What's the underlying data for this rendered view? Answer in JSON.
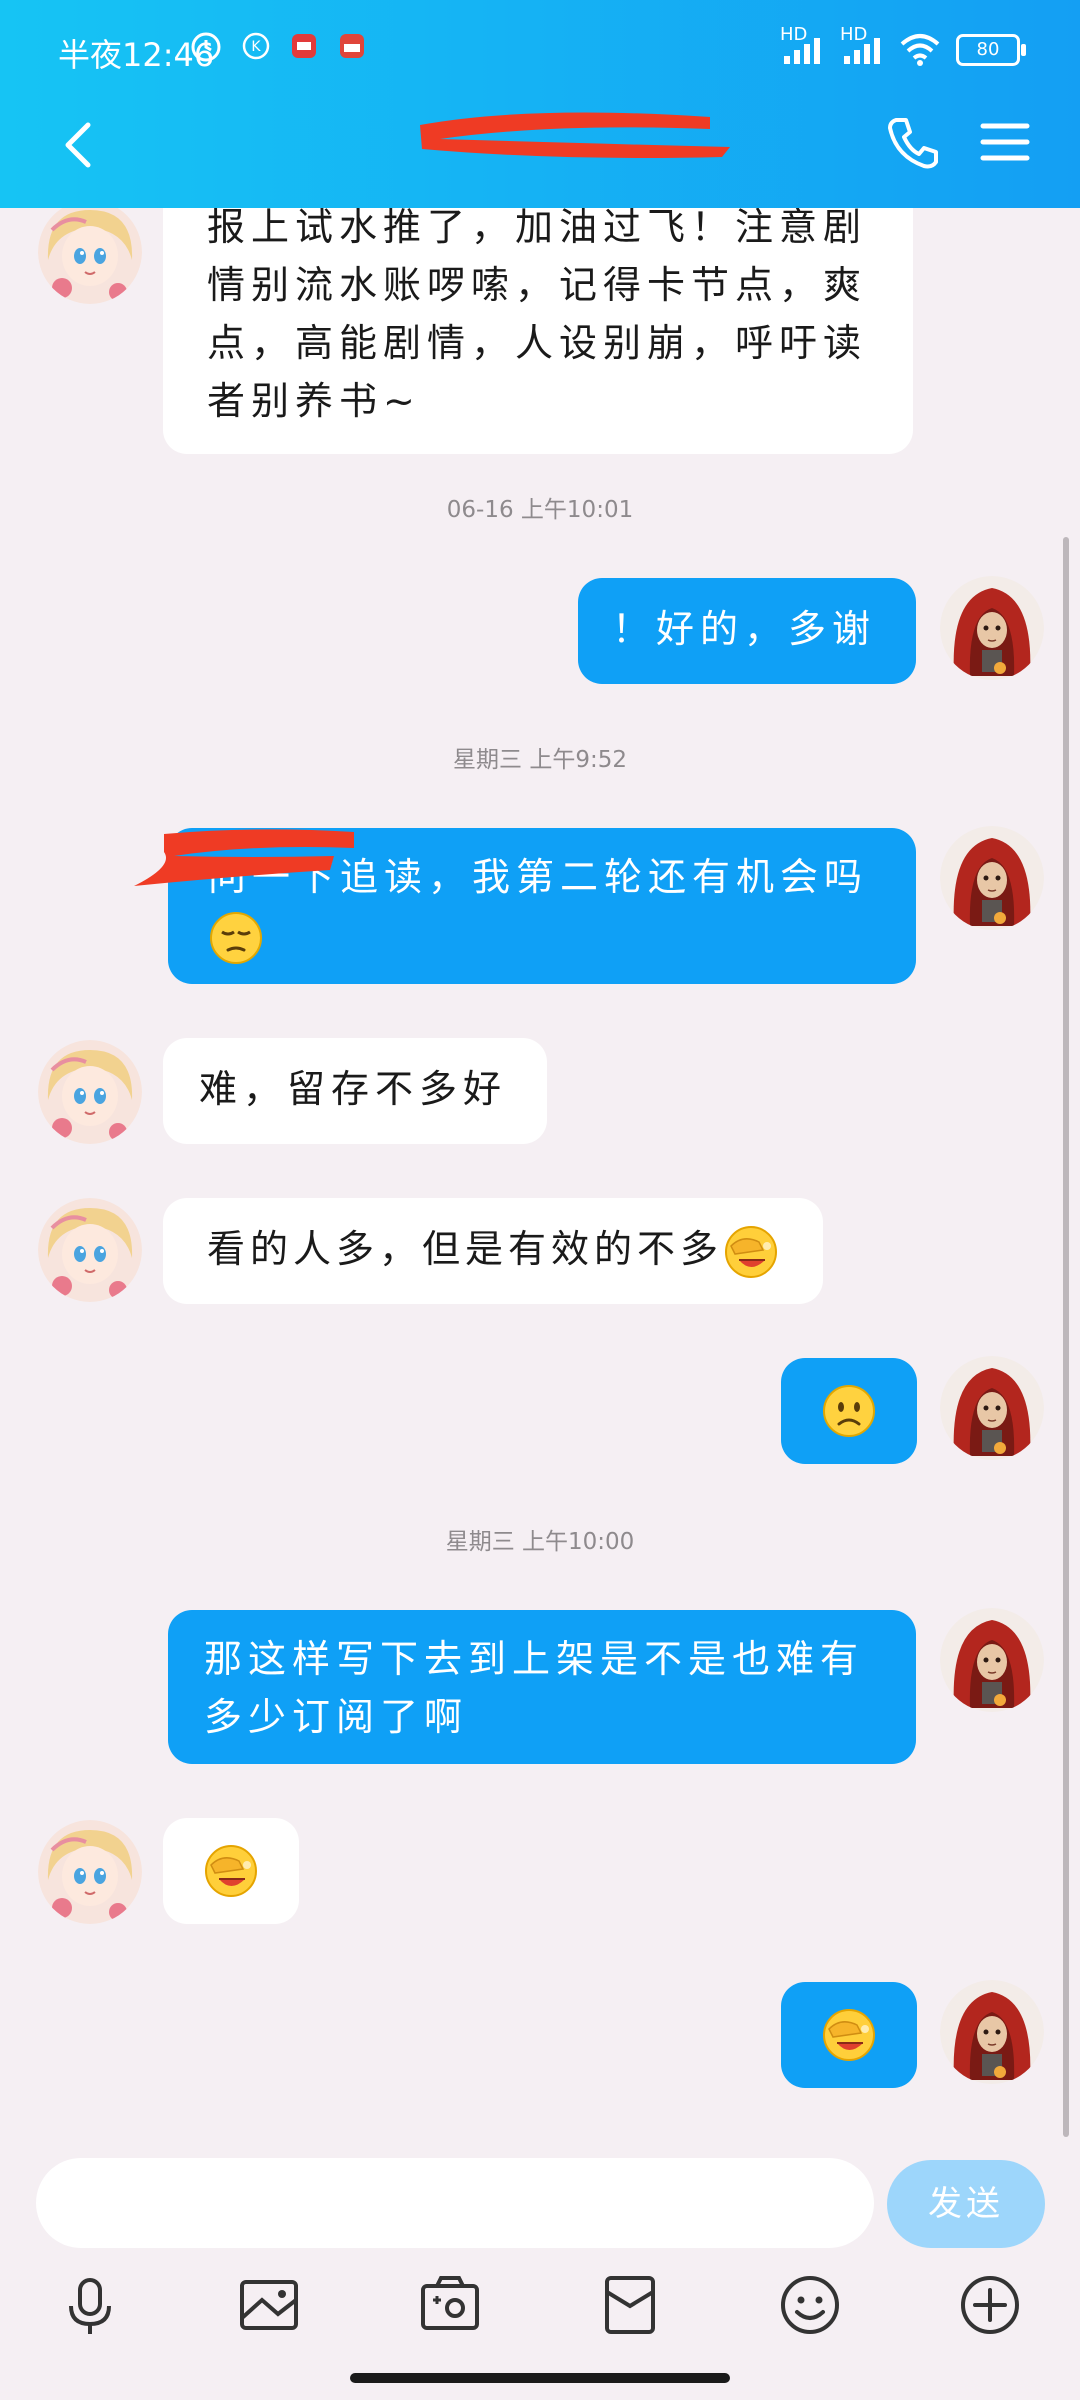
{
  "status_bar": {
    "time": "半夜12:46",
    "battery": "80",
    "signal1_label": "HD",
    "signal2_label": "HD"
  },
  "header": {
    "title": "",
    "back_icon": "chevron-left-icon",
    "call_icon": "phone-icon",
    "menu_icon": "menu-icon"
  },
  "messages": [
    {
      "side": "in",
      "text": "报上试水推了，加油过飞！注意剧情别流水账啰嗦，记得卡节点，爽点，高能剧情，人设别崩，呼吁读者别养书~"
    },
    {
      "timestamp": "06-16  上午10:01"
    },
    {
      "side": "out",
      "text": "！好的，多谢"
    },
    {
      "timestamp": "星期三  上午9:52"
    },
    {
      "side": "out",
      "text": "问一下追读，我第二轮还有机会吗"
    },
    {
      "side": "in",
      "text": "难，留存不多好"
    },
    {
      "side": "in",
      "text": "看的人多，但是有效的不多"
    },
    {
      "side": "out",
      "emoji": "frown-emoji"
    },
    {
      "timestamp": "星期三  上午10:00"
    },
    {
      "side": "out",
      "text": "那这样写下去到上架是不是也难有多少订阅了啊"
    },
    {
      "side": "in",
      "emoji": "facepalm-emoji"
    },
    {
      "side": "out",
      "emoji": "facepalm-emoji"
    }
  ],
  "composer": {
    "placeholder": "",
    "send_label": "发送"
  },
  "toolbar": [
    "microphone-icon",
    "image-icon",
    "camera-icon",
    "red-packet-icon",
    "emoji-icon",
    "plus-icon"
  ]
}
